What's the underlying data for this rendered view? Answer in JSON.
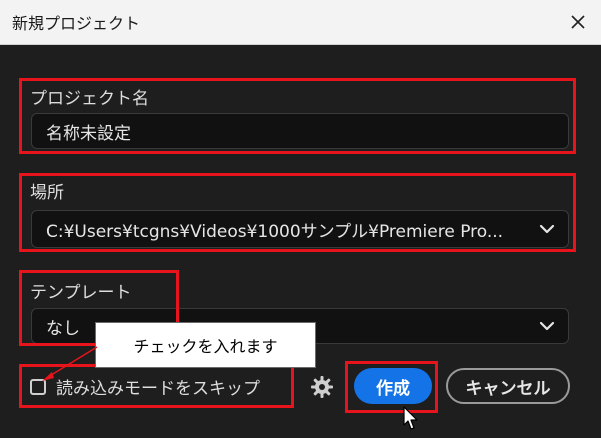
{
  "window": {
    "title": "新規プロジェクト"
  },
  "project_name": {
    "label": "プロジェクト名",
    "value": "名称未設定"
  },
  "location": {
    "label": "場所",
    "value": "C:¥Users¥tcgns¥Videos¥1000サンプル¥Premiere Pro..."
  },
  "template": {
    "label": "テンプレート",
    "value": "なし"
  },
  "skip_import": {
    "label": "読み込みモードをスキップ",
    "checked": false
  },
  "buttons": {
    "create": "作成",
    "cancel": "キャンセル"
  },
  "annotation": {
    "callout": "チェックを入れます"
  },
  "colors": {
    "accent": "#1473e6",
    "highlight": "#e8141b",
    "background": "#1e1e1e"
  },
  "icons": {
    "close": "close-icon",
    "chevron": "chevron-down-icon",
    "gear": "gear-icon",
    "cursor": "cursor-icon"
  }
}
